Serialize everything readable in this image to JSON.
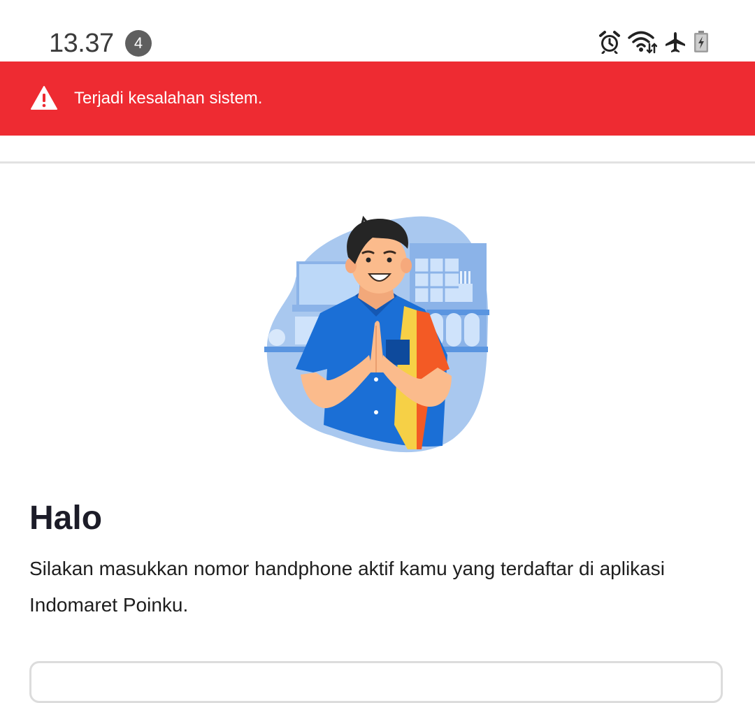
{
  "status_bar": {
    "time": "13.37",
    "notification_count": "4",
    "icons": [
      "alarm-icon",
      "wifi-icon",
      "airplane-mode-icon",
      "battery-charging-icon"
    ]
  },
  "error_banner": {
    "message": "Terjadi kesalahan sistem.",
    "icon": "warning-icon",
    "color": "#ee2b32"
  },
  "main": {
    "illustration": "greeting-cashier-illustration",
    "title": "Halo",
    "instruction": "Silakan masukkan nomor handphone aktif kamu yang terdaftar di aplikasi Indomaret Poinku."
  },
  "phone_input": {
    "value": ""
  }
}
